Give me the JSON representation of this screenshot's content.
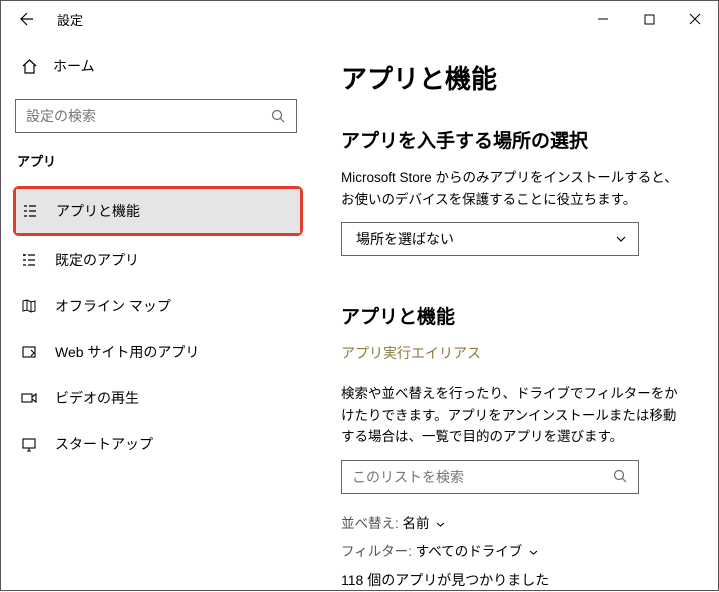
{
  "titlebar": {
    "title": "設定"
  },
  "sidebar": {
    "home": "ホーム",
    "search_placeholder": "設定の検索",
    "section": "アプリ",
    "items": [
      {
        "label": "アプリと機能"
      },
      {
        "label": "既定のアプリ"
      },
      {
        "label": "オフライン マップ"
      },
      {
        "label": "Web サイト用のアプリ"
      },
      {
        "label": "ビデオの再生"
      },
      {
        "label": "スタートアップ"
      }
    ]
  },
  "main": {
    "title": "アプリと機能",
    "section1": {
      "heading": "アプリを入手する場所の選択",
      "desc": "Microsoft Store からのみアプリをインストールすると、お使いのデバイスを保護することに役立ちます。",
      "dropdown_value": "場所を選ばない"
    },
    "section2": {
      "heading": "アプリと機能",
      "link": "アプリ実行エイリアス",
      "desc": "検索や並べ替えを行ったり、ドライブでフィルターをかけたりできます。アプリをアンインストールまたは移動する場合は、一覧で目的のアプリを選びます。",
      "search_placeholder": "このリストを検索",
      "sort_label": "並べ替え:",
      "sort_value": "名前",
      "filter_label": "フィルター:",
      "filter_value": "すべてのドライブ",
      "count": "118 個のアプリが見つかりました"
    }
  }
}
